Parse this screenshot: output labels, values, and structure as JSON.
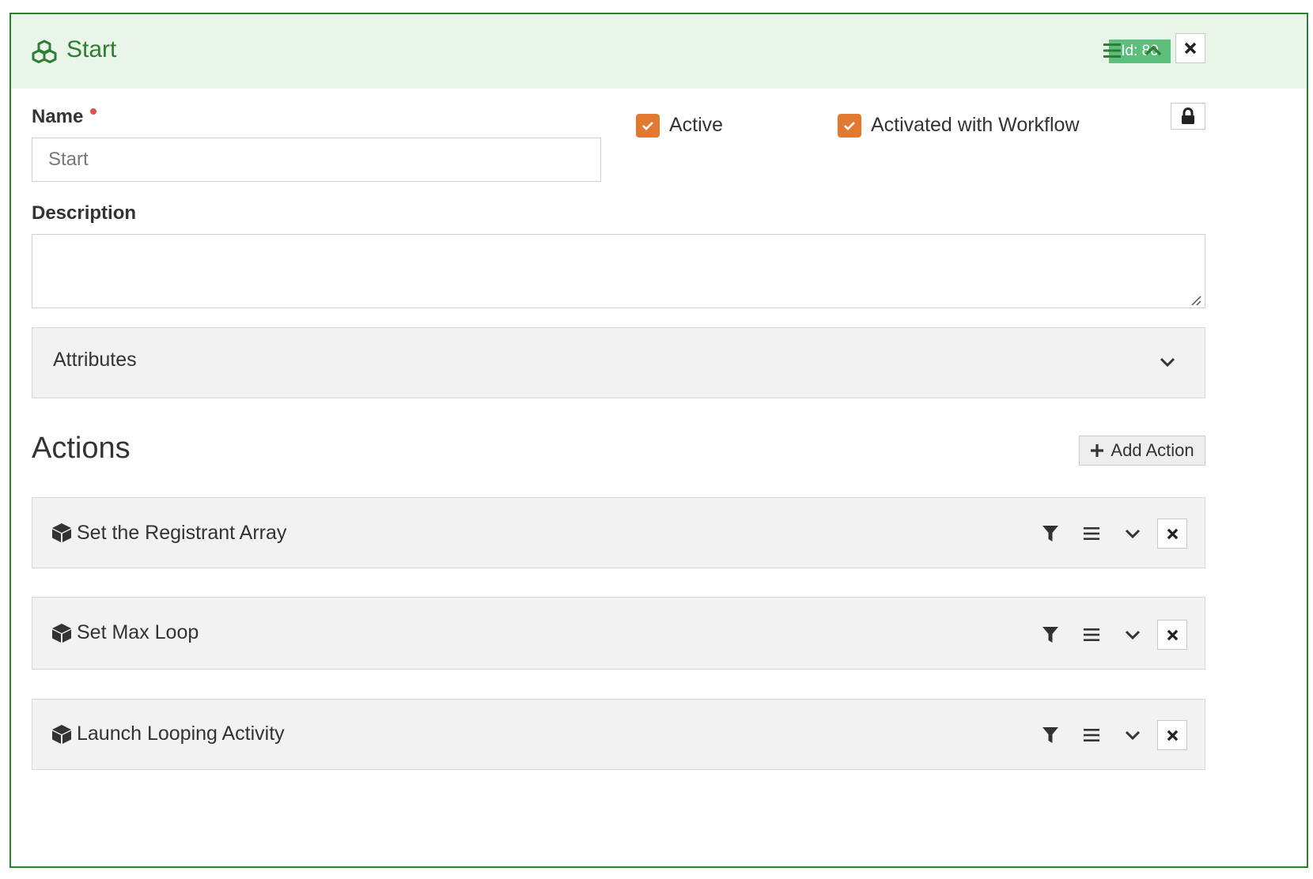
{
  "header": {
    "title": "Start",
    "icon": "cubes-icon",
    "id_badge": "Id: 80",
    "accent_color": "#2e7d32",
    "badge_color": "#5cbf7b"
  },
  "form": {
    "name_label": "Name",
    "name_value": "",
    "name_placeholder": "Start",
    "name_required": true,
    "description_label": "Description",
    "description_value": "",
    "active_label": "Active",
    "active_checked": true,
    "activated_with_workflow_label": "Activated with Workflow",
    "activated_with_workflow_checked": true,
    "checkbox_color": "#e07a30"
  },
  "attributes": {
    "title": "Attributes",
    "collapsed": true
  },
  "actions": {
    "heading": "Actions",
    "add_label": "Add Action",
    "items": [
      {
        "title": "Set the Registrant Array"
      },
      {
        "title": "Set Max Loop"
      },
      {
        "title": "Launch Looping Activity"
      }
    ]
  }
}
